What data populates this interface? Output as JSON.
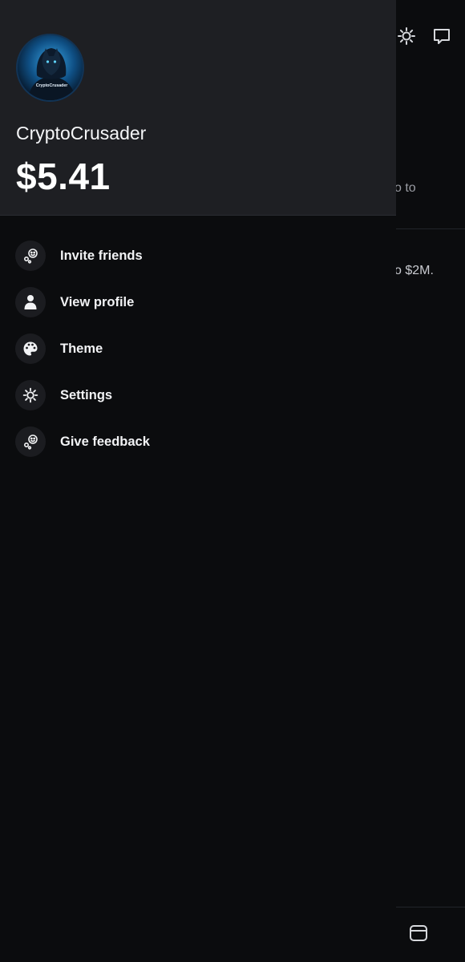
{
  "background": {
    "text_line_1": "o to",
    "text_line_2": "o $2M."
  },
  "icons": {
    "top_right": [
      "settings-icon",
      "chat-icon"
    ],
    "bottom": "tab-icon"
  },
  "drawer": {
    "avatar_caption": "CryptoCrusader",
    "username": "CryptoCrusader",
    "balance": "$5.41",
    "menu": [
      {
        "label": "Invite friends",
        "icon": "invite-friends-icon"
      },
      {
        "label": "View profile",
        "icon": "person-icon"
      },
      {
        "label": "Theme",
        "icon": "palette-icon"
      },
      {
        "label": "Settings",
        "icon": "gear-icon"
      },
      {
        "label": "Give feedback",
        "icon": "feedback-icon"
      }
    ]
  },
  "colors": {
    "drawer_header_bg": "#1e1f23",
    "drawer_bg": "#0b0c0e",
    "icon_circle_bg": "#1b1c20",
    "text_primary": "#f2f3f5"
  }
}
